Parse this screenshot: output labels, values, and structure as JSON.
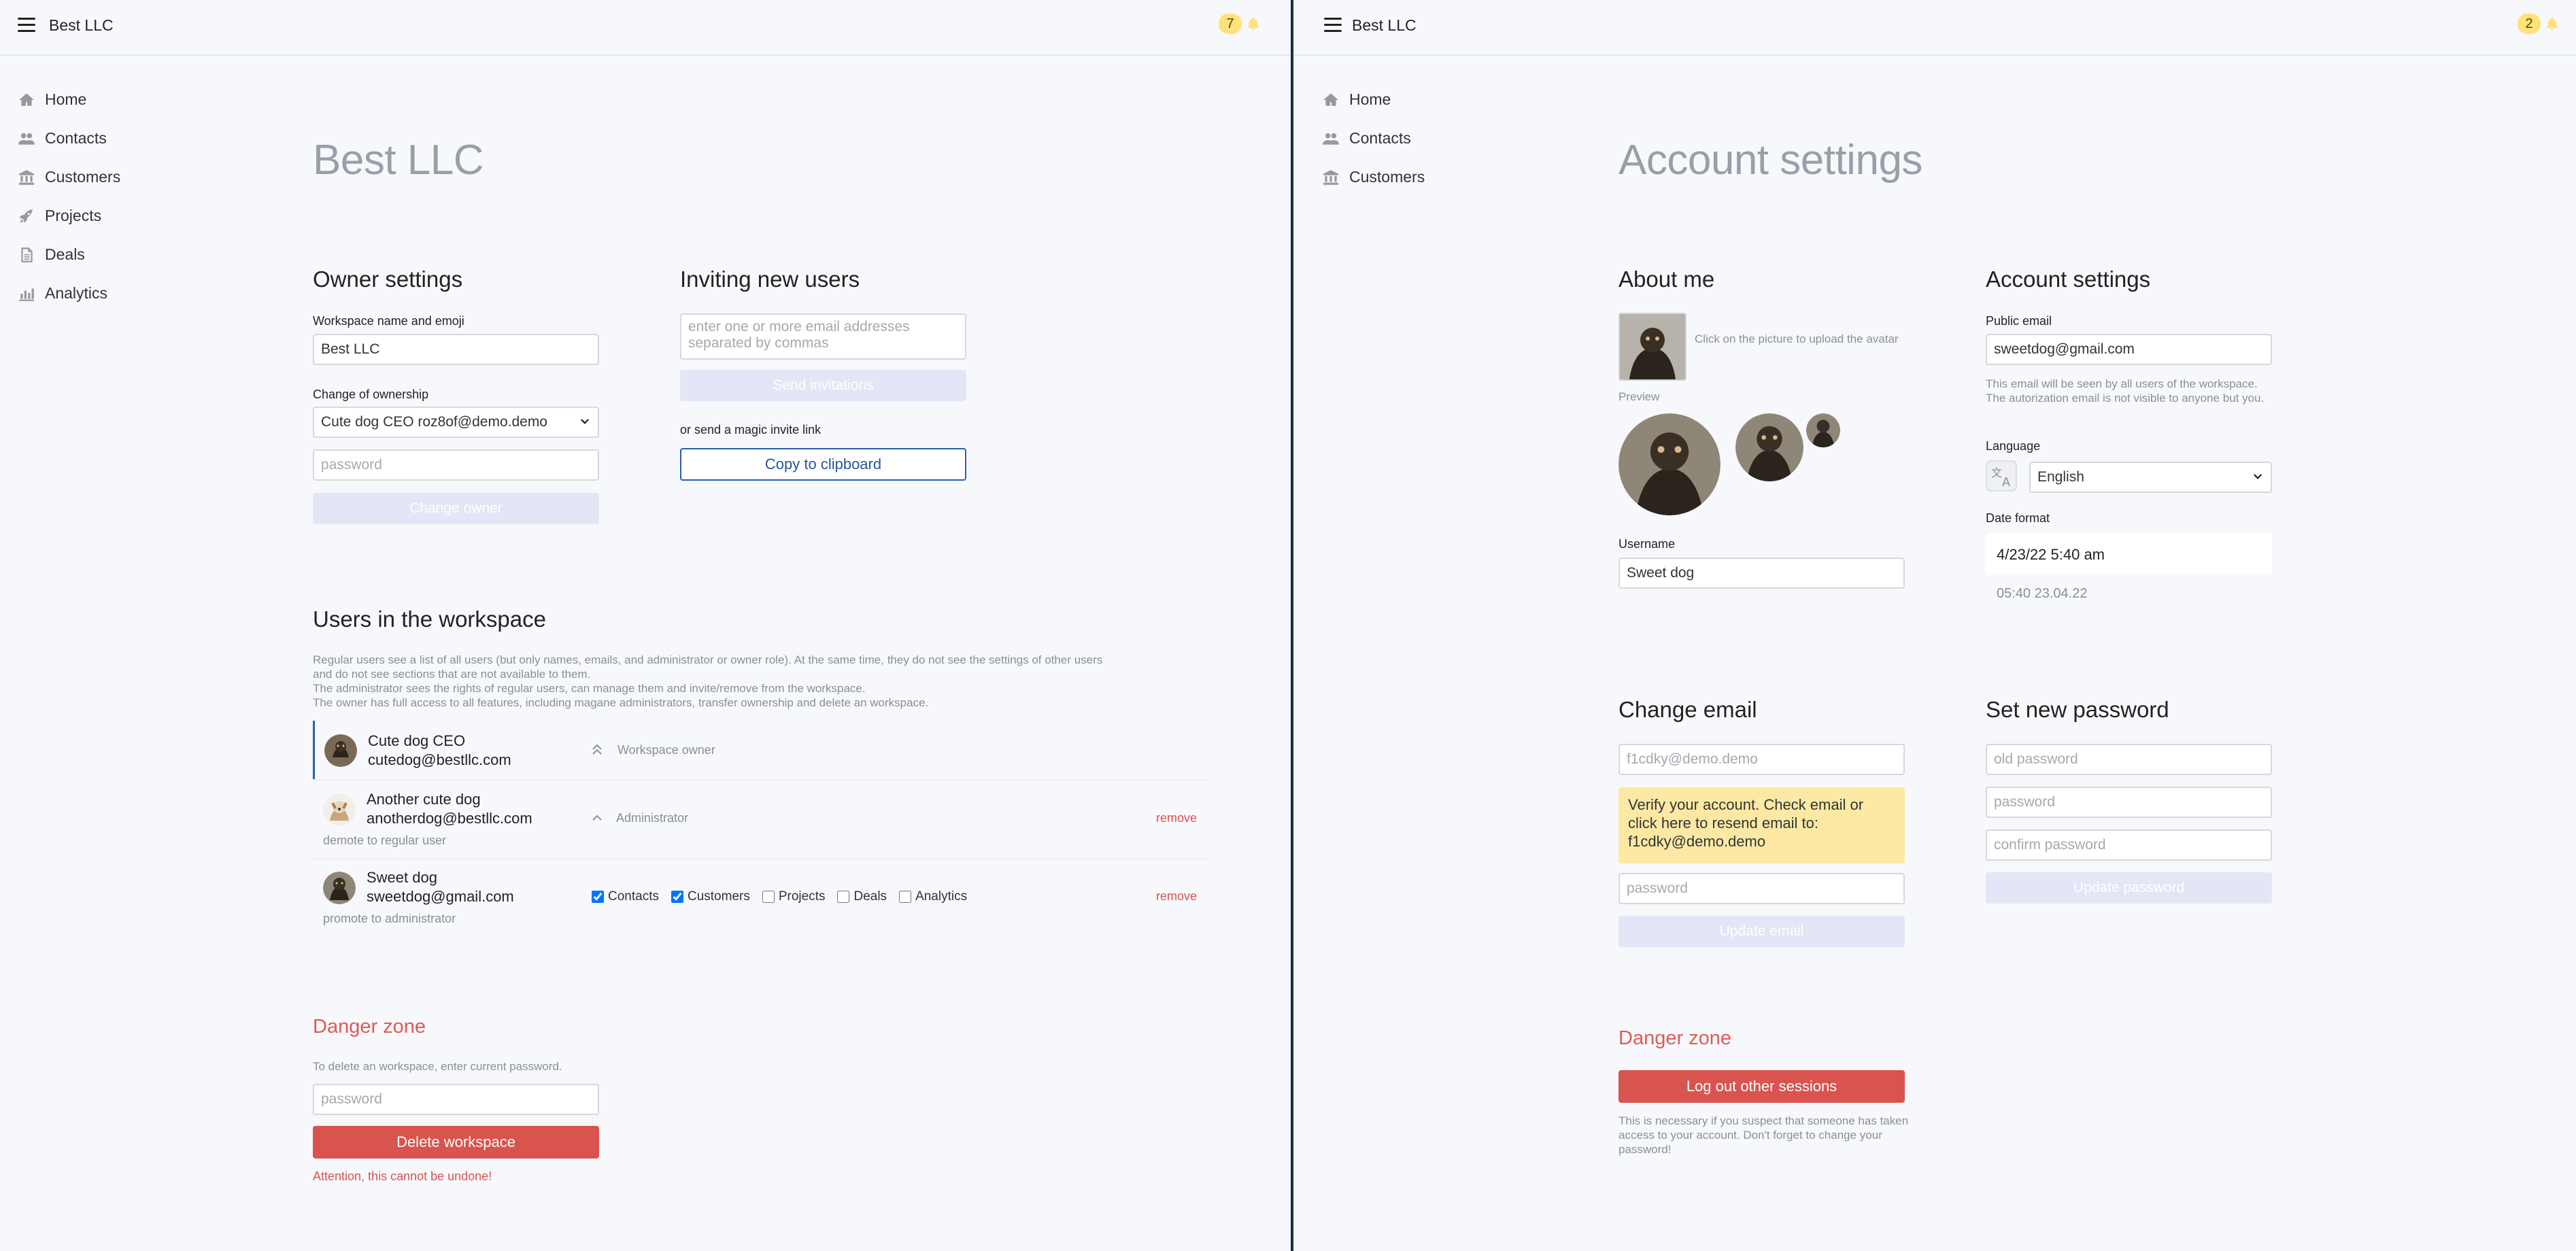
{
  "left": {
    "brand": "Best LLC",
    "notifications": "7",
    "nav": [
      {
        "label": "Home",
        "icon": "home-icon"
      },
      {
        "label": "Contacts",
        "icon": "users-icon"
      },
      {
        "label": "Customers",
        "icon": "bank-icon"
      },
      {
        "label": "Projects",
        "icon": "rocket-icon"
      },
      {
        "label": "Deals",
        "icon": "document-icon"
      },
      {
        "label": "Analytics",
        "icon": "bar-chart-icon"
      }
    ],
    "page_title": "Best LLC",
    "owner_settings": {
      "title": "Owner settings",
      "workspace_label": "Workspace name and emoji",
      "workspace_value": "Best LLC",
      "ownership_label": "Change of ownership",
      "ownership_selected": "Cute dog CEO roz8of@demo.demo",
      "password_placeholder": "password",
      "change_owner": "Change owner"
    },
    "invite": {
      "title": "Inviting new users",
      "emails_placeholder": "enter one or more email addresses separated by commas",
      "send": "Send invitations",
      "magic_label": "or send a magic invite link",
      "copy": "Copy to clipboard"
    },
    "users": {
      "title": "Users in the workspace",
      "desc": [
        "Regular users see a list of all users (but only names, emails, and administrator or owner role). At the same time, they do not see the settings of other users",
        "and do not see sections that are not available to them.",
        "The administrator sees the rights of regular users, can manage them and invite/remove from the workspace.",
        "The owner has full access to all features, including magane administrators, transfer ownership and delete an workspace."
      ],
      "rows": [
        {
          "name": "Cute dog CEO",
          "email": "cutedog@bestllc.com",
          "role": "Workspace owner"
        },
        {
          "name": "Another cute dog",
          "email": "anotherdog@bestllc.com",
          "role": "Administrator",
          "sub": "demote to regular user",
          "remove": "remove"
        },
        {
          "name": "Sweet dog",
          "email": "sweetdog@gmail.com",
          "sub": "promote to administrator",
          "remove": "remove",
          "permissions": [
            {
              "label": "Contacts",
              "checked": true
            },
            {
              "label": "Customers",
              "checked": true
            },
            {
              "label": "Projects",
              "checked": false
            },
            {
              "label": "Deals",
              "checked": false
            },
            {
              "label": "Analytics",
              "checked": false
            }
          ]
        }
      ]
    },
    "danger": {
      "title": "Danger zone",
      "desc": "To delete an workspace, enter current password.",
      "password_placeholder": "password",
      "delete": "Delete workspace",
      "warning": "Attention, this cannot be undone!"
    }
  },
  "right": {
    "brand": "Best LLC",
    "notifications": "2",
    "nav": [
      {
        "label": "Home",
        "icon": "home-icon"
      },
      {
        "label": "Contacts",
        "icon": "users-icon"
      },
      {
        "label": "Customers",
        "icon": "bank-icon"
      }
    ],
    "page_title": "Account settings",
    "about": {
      "title": "About me",
      "upload_hint": "Click on the picture to upload the avatar",
      "preview": "Preview",
      "username_label": "Username",
      "username_value": "Sweet dog"
    },
    "account": {
      "title": "Account settings",
      "email_label": "Public email",
      "email_value": "sweetdog@gmail.com",
      "email_hint": "This email will be seen by all users of the workspace. The autorization email is not visible to anyone but you.",
      "language_label": "Language",
      "language_value": "English",
      "date_label": "Date format",
      "date_options": [
        "4/23/22 5:40 am",
        "05:40 23.04.22"
      ]
    },
    "change_email": {
      "title": "Change email",
      "email_placeholder": "f1cdky@demo.demo",
      "verify_text": "Verify your account. Check email or click here to resend email to:",
      "verify_email": "f1cdky@demo.demo",
      "password_placeholder": "password",
      "update": "Update email"
    },
    "password": {
      "title": "Set new password",
      "old_placeholder": "old password",
      "new_placeholder": "password",
      "confirm_placeholder": "confirm password",
      "update": "Update password"
    },
    "danger": {
      "title": "Danger zone",
      "logout": "Log out other sessions",
      "desc": "This is necessary if you suspect that someone has taken access to your account. Don't forget to change your password!"
    }
  }
}
